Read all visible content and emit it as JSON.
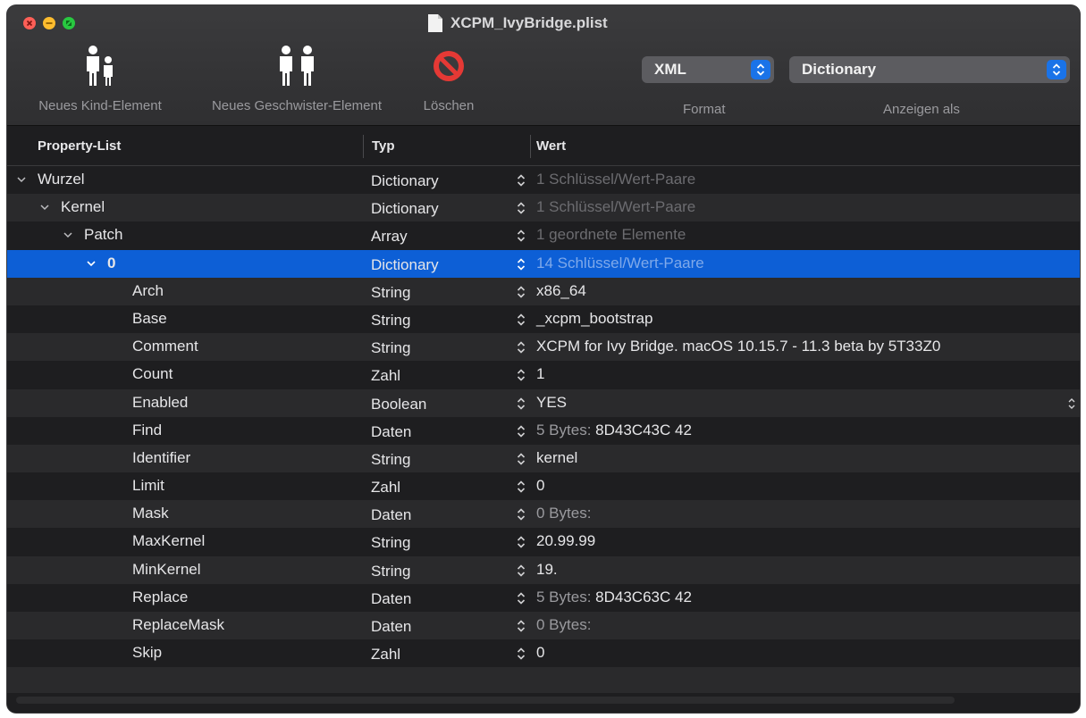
{
  "window": {
    "title": "XCPM_IvyBridge.plist",
    "colors": {
      "selection": "#0d5fd6",
      "background": "#1e1e20",
      "alt_row": "#2a2a2c",
      "accent": "#1a73e8"
    }
  },
  "toolbar": {
    "new_child_label": "Neues Kind-Element",
    "new_sibling_label": "Neues Geschwister-Element",
    "delete_label": "Löschen",
    "format_value": "XML",
    "format_label": "Format",
    "view_as_value": "Dictionary",
    "view_as_label": "Anzeigen als"
  },
  "columns": {
    "property": "Property-List",
    "type": "Typ",
    "value": "Wert"
  },
  "rows": [
    {
      "key": "Wurzel",
      "type": "Dictionary",
      "value": "1 Schlüssel/Wert-Paare"
    },
    {
      "key": "Kernel",
      "type": "Dictionary",
      "value": "1 Schlüssel/Wert-Paare"
    },
    {
      "key": "Patch",
      "type": "Array",
      "value": "1 geordnete Elemente"
    },
    {
      "key": "0",
      "type": "Dictionary",
      "value": "14 Schlüssel/Wert-Paare"
    },
    {
      "key": "Arch",
      "type": "String",
      "value": "x86_64"
    },
    {
      "key": "Base",
      "type": "String",
      "value": "_xcpm_bootstrap"
    },
    {
      "key": "Comment",
      "type": "String",
      "value": "XCPM for Ivy Bridge. macOS 10.15.7 - 11.3 beta by 5T33Z0"
    },
    {
      "key": "Count",
      "type": "Zahl",
      "value": "1"
    },
    {
      "key": "Enabled",
      "type": "Boolean",
      "value": "YES"
    },
    {
      "key": "Find",
      "type": "Daten",
      "value_prefix": "5 Bytes:",
      "value": "8D43C43C 42"
    },
    {
      "key": "Identifier",
      "type": "String",
      "value": "kernel"
    },
    {
      "key": "Limit",
      "type": "Zahl",
      "value": "0"
    },
    {
      "key": "Mask",
      "type": "Daten",
      "value_prefix": "0 Bytes:",
      "value": ""
    },
    {
      "key": "MaxKernel",
      "type": "String",
      "value": "20.99.99"
    },
    {
      "key": "MinKernel",
      "type": "String",
      "value": "19."
    },
    {
      "key": "Replace",
      "type": "Daten",
      "value_prefix": "5 Bytes:",
      "value": "8D43C63C 42"
    },
    {
      "key": "ReplaceMask",
      "type": "Daten",
      "value_prefix": "0 Bytes:",
      "value": ""
    },
    {
      "key": "Skip",
      "type": "Zahl",
      "value": "0"
    }
  ]
}
